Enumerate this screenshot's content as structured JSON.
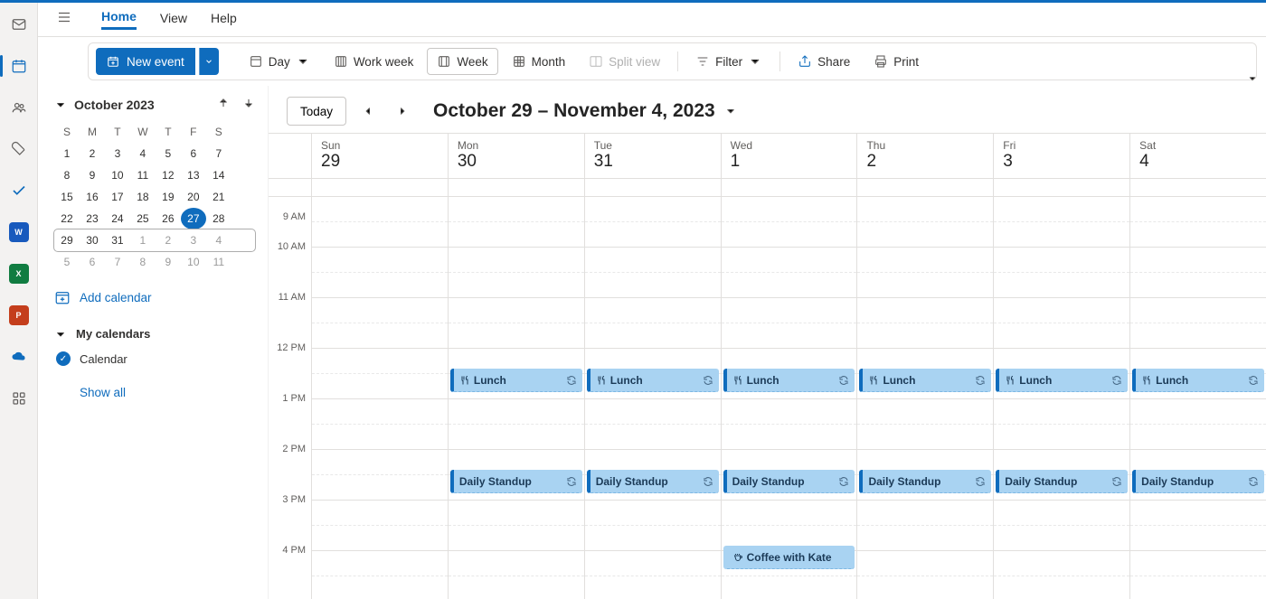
{
  "tabs": {
    "home": "Home",
    "view": "View",
    "help": "Help"
  },
  "ribbon": {
    "new_event": "New event",
    "day": "Day",
    "work_week": "Work week",
    "week": "Week",
    "month": "Month",
    "split_view": "Split view",
    "filter": "Filter",
    "share": "Share",
    "print": "Print"
  },
  "sidebar": {
    "month_label": "October 2023",
    "dow": [
      "S",
      "M",
      "T",
      "W",
      "T",
      "F",
      "S"
    ],
    "weeks": [
      {
        "cells": [
          {
            "d": "1"
          },
          {
            "d": "2"
          },
          {
            "d": "3"
          },
          {
            "d": "4"
          },
          {
            "d": "5"
          },
          {
            "d": "6"
          },
          {
            "d": "7"
          }
        ]
      },
      {
        "cells": [
          {
            "d": "8"
          },
          {
            "d": "9"
          },
          {
            "d": "10"
          },
          {
            "d": "11"
          },
          {
            "d": "12"
          },
          {
            "d": "13"
          },
          {
            "d": "14"
          }
        ]
      },
      {
        "cells": [
          {
            "d": "15"
          },
          {
            "d": "16"
          },
          {
            "d": "17"
          },
          {
            "d": "18"
          },
          {
            "d": "19"
          },
          {
            "d": "20"
          },
          {
            "d": "21"
          }
        ]
      },
      {
        "cells": [
          {
            "d": "22"
          },
          {
            "d": "23"
          },
          {
            "d": "24"
          },
          {
            "d": "25"
          },
          {
            "d": "26"
          },
          {
            "d": "27",
            "today": true
          },
          {
            "d": "28"
          }
        ]
      },
      {
        "selected": true,
        "cells": [
          {
            "d": "29"
          },
          {
            "d": "30"
          },
          {
            "d": "31"
          },
          {
            "d": "1",
            "dim": true
          },
          {
            "d": "2",
            "dim": true
          },
          {
            "d": "3",
            "dim": true
          },
          {
            "d": "4",
            "dim": true
          }
        ]
      },
      {
        "cells": [
          {
            "d": "5",
            "dim": true
          },
          {
            "d": "6",
            "dim": true
          },
          {
            "d": "7",
            "dim": true
          },
          {
            "d": "8",
            "dim": true
          },
          {
            "d": "9",
            "dim": true
          },
          {
            "d": "10",
            "dim": true
          },
          {
            "d": "11",
            "dim": true
          }
        ]
      }
    ],
    "add_calendar": "Add calendar",
    "my_calendars": "My calendars",
    "calendar_item": "Calendar",
    "show_all": "Show all"
  },
  "calhead": {
    "today": "Today",
    "range": "October 29 – November 4, 2023"
  },
  "days": [
    {
      "dow": "Sun",
      "num": "29"
    },
    {
      "dow": "Mon",
      "num": "30"
    },
    {
      "dow": "Tue",
      "num": "31"
    },
    {
      "dow": "Wed",
      "num": "1"
    },
    {
      "dow": "Thu",
      "num": "2"
    },
    {
      "dow": "Fri",
      "num": "3"
    },
    {
      "dow": "Sat",
      "num": "4"
    }
  ],
  "hours": [
    "9 AM",
    "10 AM",
    "11 AM",
    "12 PM",
    "1 PM",
    "2 PM",
    "3 PM",
    "4 PM"
  ],
  "events": {
    "lunch": "Lunch",
    "standup": "Daily Standup",
    "coffee": "Coffee with Kate"
  },
  "rail_badges": {
    "word": "W",
    "excel": "X",
    "ppt": "P"
  }
}
